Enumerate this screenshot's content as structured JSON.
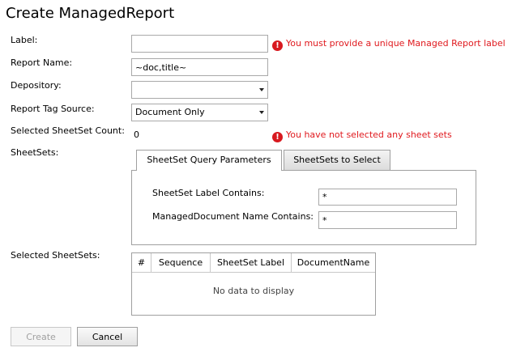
{
  "page": {
    "title": "Create ManagedReport"
  },
  "form": {
    "label": {
      "caption": "Label:",
      "value": "",
      "error": "You must provide a unique Managed Report label"
    },
    "report_name": {
      "caption": "Report Name:",
      "value": "~doc,title~"
    },
    "depository": {
      "caption": "Depository:",
      "selected": ""
    },
    "report_tag_source": {
      "caption": "Report Tag Source:",
      "selected": "Document Only"
    },
    "selected_sheetset_count": {
      "caption": "Selected SheetSet Count:",
      "value": "0",
      "error": "You have not selected any sheet sets"
    },
    "sheetsets": {
      "caption": "SheetSets:"
    },
    "selected_sheetsets": {
      "caption": "Selected SheetSets:"
    }
  },
  "tabs": [
    {
      "label": "SheetSet Query Parameters",
      "active": true
    },
    {
      "label": "SheetSets to Select",
      "active": false
    }
  ],
  "query_params": {
    "sheetset_label": {
      "caption": "SheetSet Label Contains:",
      "value": "*"
    },
    "doc_name": {
      "caption": "ManagedDocument Name Contains:",
      "value": "*"
    }
  },
  "grid": {
    "columns": [
      "#",
      "Sequence",
      "SheetSet Label",
      "DocumentName"
    ],
    "empty_text": "No data to display"
  },
  "buttons": {
    "create": "Create",
    "cancel": "Cancel"
  },
  "icons": {
    "error": "!",
    "dropdown": "chevron-down-icon"
  },
  "colors": {
    "error_text": "#e0191e",
    "error_icon": "#d8191f"
  }
}
